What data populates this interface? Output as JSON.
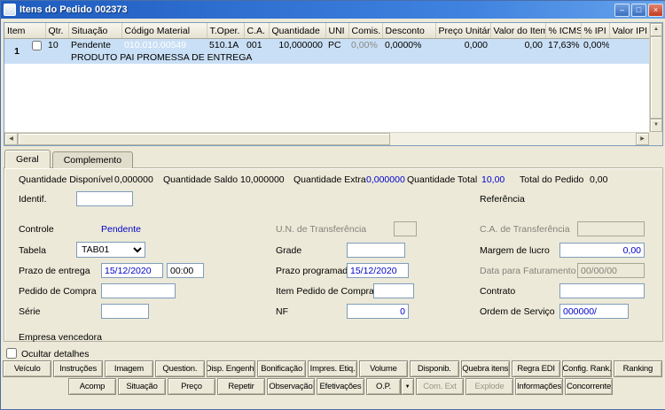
{
  "window": {
    "title": "Itens do Pedido 002373"
  },
  "icons": {
    "minimize": "–",
    "maximize": "□",
    "close": "×",
    "dropdown": "▼",
    "scroll_left": "◀",
    "scroll_right": "▶",
    "scroll_up": "▲",
    "scroll_down": "▼"
  },
  "grid": {
    "columns": [
      "Item",
      "Qtr.",
      "Situação",
      "Código Material",
      "T.Oper.",
      "C.A.",
      "Quantidade",
      "UNI",
      "Comis.",
      "Desconto",
      "Preço Unitário",
      "Valor do Item",
      "% ICMS",
      "% IPI",
      "Valor IPI"
    ],
    "row": {
      "item": "1",
      "qtr": "10",
      "situacao": "Pendente",
      "codigo_material": "010.010.00549",
      "t_oper": "510.1A",
      "ca": "001",
      "quantidade": "10,000000",
      "uni": "PC",
      "comis": "0,00%",
      "desconto": "0,0000%",
      "preco_unitario": "0,000",
      "valor_item": "0,00",
      "icms": "17,63%",
      "ipi": "0,00%",
      "valor_ipi": "",
      "descricao": "PRODUTO PAI PROMESSA DE ENTREGA"
    }
  },
  "tabs": {
    "geral": "Geral",
    "complemento": "Complemento"
  },
  "form": {
    "quantidade_disponivel": {
      "label": "Quantidade Disponível",
      "value": "0,000000"
    },
    "quantidade_saldo": {
      "label": "Quantidade Saldo",
      "value": "10,000000"
    },
    "quantidade_extra": {
      "label": "Quantidade Extra",
      "value": "0,000000"
    },
    "quantidade_total": {
      "label": "Quantidade Total",
      "value": "10,00"
    },
    "total_pedido": {
      "label": "Total do Pedido",
      "value": "0,00"
    },
    "identif": {
      "label": "Identif.",
      "value": ""
    },
    "referencia": {
      "label": "Referência"
    },
    "controle": {
      "label": "Controle",
      "value": "Pendente"
    },
    "un_transferencia": {
      "label": "U.N. de Transferência",
      "value": ""
    },
    "ca_transferencia": {
      "label": "C.A. de Transferência",
      "value": ""
    },
    "tabela": {
      "label": "Tabela",
      "value": "TAB01"
    },
    "grade": {
      "label": "Grade",
      "value": ""
    },
    "margem_lucro": {
      "label": "Margem de lucro",
      "value": "0,00"
    },
    "prazo_entrega": {
      "label": "Prazo de entrega",
      "value": "15/12/2020",
      "hora": "00:00"
    },
    "prazo_programado": {
      "label": "Prazo programado",
      "value": "15/12/2020"
    },
    "data_faturamento": {
      "label": "Data para Faturamento",
      "value": "00/00/00"
    },
    "pedido_compra": {
      "label": "Pedido de Compra",
      "value": ""
    },
    "item_pedido_compra": {
      "label": "Item Pedido de Compra",
      "value": ""
    },
    "contrato": {
      "label": "Contrato",
      "value": ""
    },
    "serie": {
      "label": "Série",
      "value": ""
    },
    "nf": {
      "label": "NF",
      "value": "0"
    },
    "ordem_servico": {
      "label": "Ordem de Serviço",
      "value": "000000/"
    },
    "empresa_vencedora": {
      "label": "Empresa vencedora"
    }
  },
  "options": {
    "ocultar_detalhes": "Ocultar detalhes"
  },
  "buttons_row1": [
    "Veículo",
    "Instruções",
    "Imagem",
    "Question.",
    "Disp. Engenh.",
    "Bonificação",
    "Impres. Etiq.",
    "Volume",
    "Disponib.",
    "Quebra itens",
    "Regra EDI",
    "Config. Rank.",
    "Ranking"
  ],
  "buttons_row2": [
    "Acomp",
    "Situação",
    "Preço",
    "Repetir",
    "Observação",
    "Efetivações",
    "O.P.",
    "Com. Ext",
    "Explode",
    "Informações",
    "Concorrente"
  ],
  "colors": {
    "accent_blue": "#0000c8",
    "selection": "#2a5cb8",
    "row_highlight": "#c9dff5",
    "panel": "#ece9d8"
  }
}
